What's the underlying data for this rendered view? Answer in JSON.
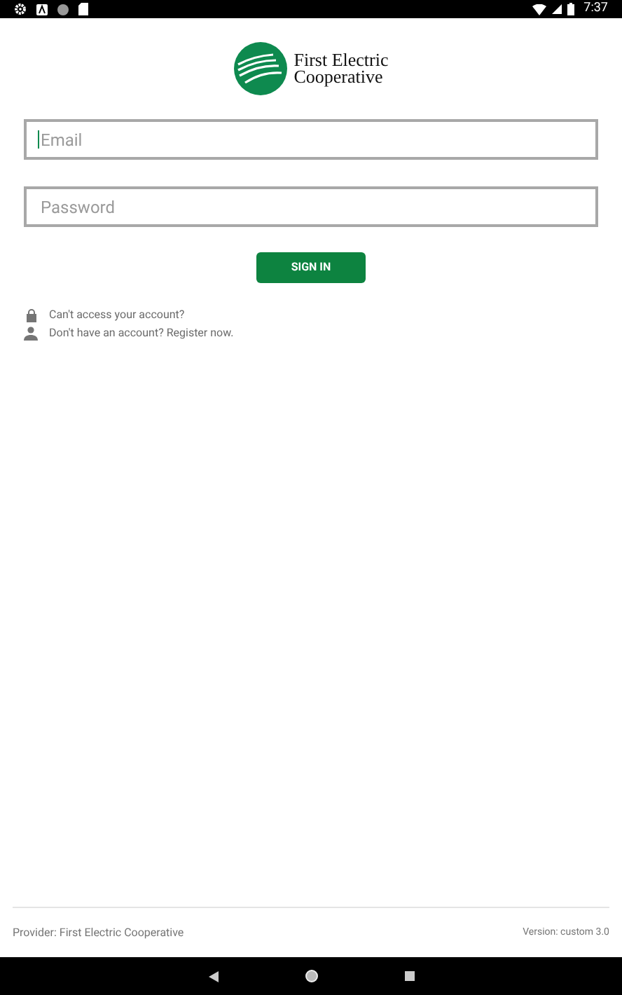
{
  "status_bar": {
    "time": "7:37"
  },
  "logo": {
    "lines": [
      "First Electric",
      "Cooperative"
    ]
  },
  "form": {
    "email": {
      "placeholder": "Email",
      "focused": true
    },
    "password": {
      "placeholder": "Password"
    },
    "submit": "SIGN IN"
  },
  "links": [
    {
      "kind": "lock",
      "label": "Can't access your account?"
    },
    {
      "kind": "person",
      "label": "Don't have an account? Register now."
    }
  ],
  "footer": {
    "provider": "Provider: First Electric Cooperative",
    "version": "Version: custom 3.0"
  }
}
